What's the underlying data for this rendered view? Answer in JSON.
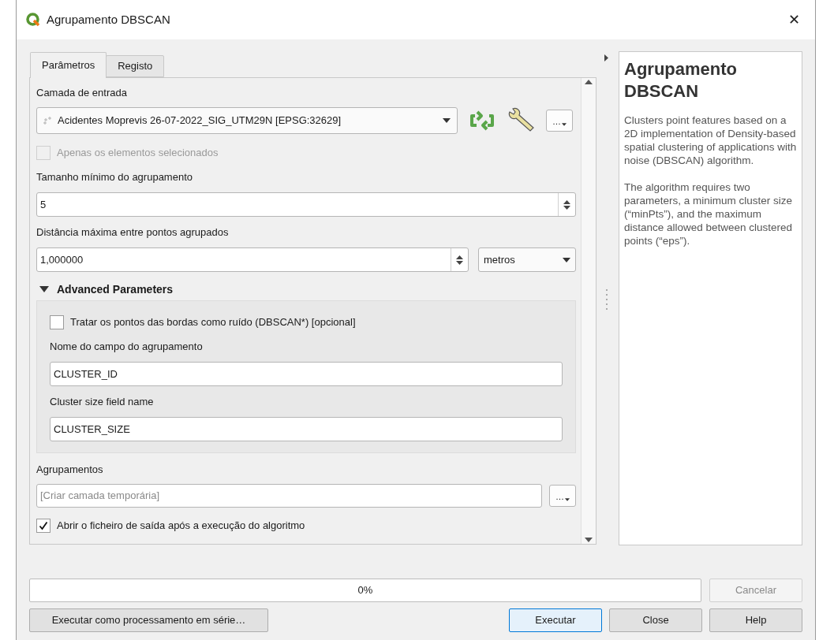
{
  "window": {
    "title": "Agrupamento DBSCAN",
    "close": "✕"
  },
  "tabs": [
    {
      "label": "Parâmetros",
      "selected": true
    },
    {
      "label": "Registo",
      "selected": false
    }
  ],
  "parameters": {
    "input_layer": {
      "label": "Camada de entrada",
      "value": "Acidentes Moprevis 26-07-2022_SIG_UTM29N [EPSG:32629]",
      "button": "…"
    },
    "selected_only": {
      "label": "Apenas os elementos selecionados",
      "checked": false,
      "disabled": true
    },
    "min_size": {
      "label": "Tamanho mínimo do agrupamento",
      "value": "5"
    },
    "max_distance": {
      "label": "Distância máxima entre pontos agrupados",
      "value": "1,000000",
      "unit": "metros"
    },
    "advanced": {
      "title": "Advanced Parameters",
      "expanded": true,
      "items": [
        {
          "kind": "checkbox",
          "label": "Tratar os pontos das bordas como ruído (DBSCAN*) [opcional]",
          "checked": false
        },
        {
          "kind": "text",
          "label": "Nome do campo do agrupamento",
          "value": "CLUSTER_ID"
        },
        {
          "kind": "text",
          "label": "Cluster size field name",
          "value": "CLUSTER_SIZE"
        }
      ]
    },
    "output": {
      "label": "Agrupamentos",
      "placeholder": "[Criar camada temporária]",
      "button": "…"
    },
    "open_output": {
      "label": "Abrir o ficheiro de saída após a execução do algoritmo",
      "checked": true
    }
  },
  "help": {
    "title": "Agrupamento DBSCAN",
    "paragraphs": [
      "Clusters point features based on a 2D implementation of Density-based spatial clustering of applications with noise (DBSCAN) algorithm.",
      "The algorithm requires two parameters, a minimum cluster size (“minPts”), and the maximum distance allowed between clustered points (“eps”)."
    ]
  },
  "progress": {
    "level": 0,
    "reading": "0%"
  },
  "cancel": {
    "label": "Cancelar",
    "disabled": true
  },
  "buttons": [
    {
      "label": "Executar como processamento em série…",
      "default": false
    },
    {
      "label": "Executar",
      "default": true
    },
    {
      "label": "Close",
      "default": false
    },
    {
      "label": "Help",
      "default": false
    }
  ]
}
